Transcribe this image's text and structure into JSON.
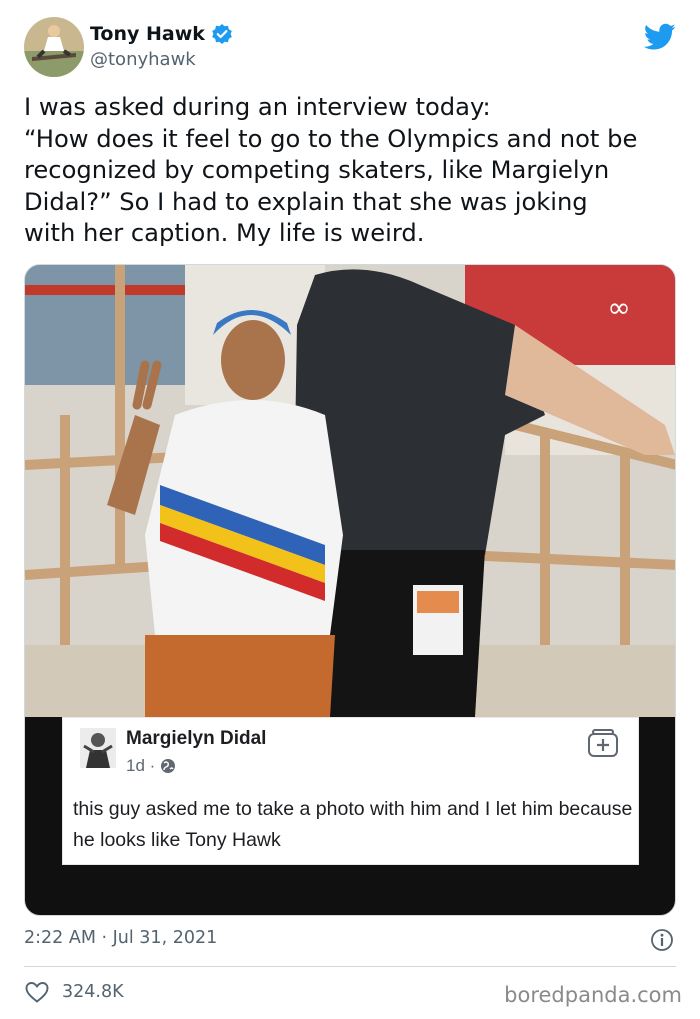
{
  "author": {
    "display_name": "Tony Hawk",
    "handle": "@tonyhawk",
    "verified": true
  },
  "tweet": {
    "text_lines": [
      "I was asked during an interview today:",
      "“How does it feel to go to the Olympics and not be",
      "recognized by competing skaters, like Margielyn",
      "Didal?” So I had to explain that she was joking",
      "with her caption. My life is weird."
    ],
    "timestamp": "2:22 AM · Jul 31, 2021",
    "like_count": "324.8K"
  },
  "embedded_post": {
    "name": "Margielyn Didal",
    "age": "1d ·",
    "text": "this guy asked me to take a photo with him and I let him because he looks like Tony Hawk"
  },
  "icons": {
    "verified": "verified-badge-icon",
    "twitter": "twitter-bird-icon",
    "info": "info-icon",
    "heart": "heart-icon",
    "globe": "globe-icon",
    "save": "save-bookmark-icon"
  },
  "colors": {
    "twitter_blue": "#1d9bf0",
    "text_primary": "#0f1419",
    "text_secondary": "#536471",
    "divider": "#cfd9de"
  },
  "watermark": "boredpanda.com"
}
